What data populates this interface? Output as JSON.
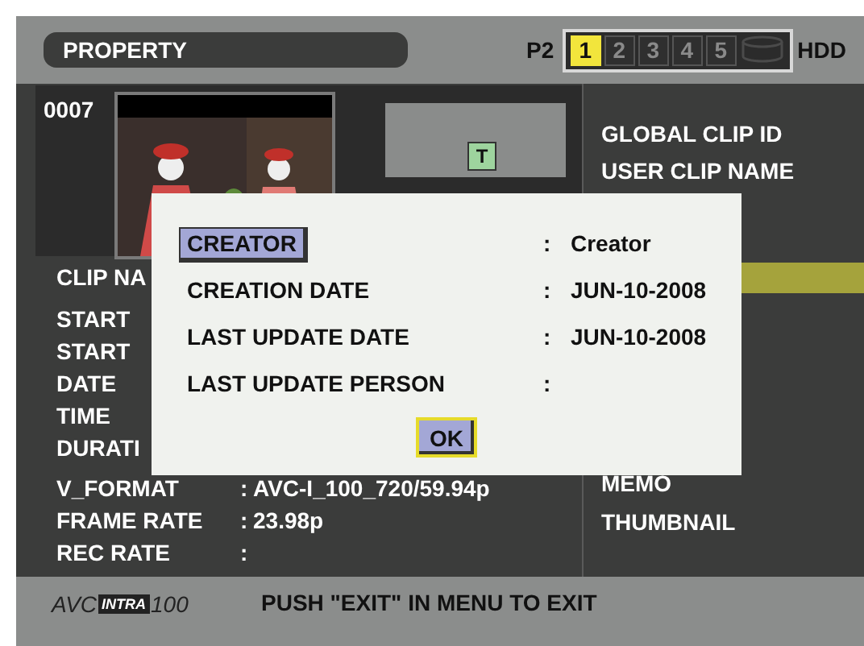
{
  "header": {
    "title": "PROPERTY",
    "media_label": "P2",
    "slots": [
      {
        "label": "1",
        "selected": true
      },
      {
        "label": "2",
        "selected": false
      },
      {
        "label": "3",
        "selected": false
      },
      {
        "label": "4",
        "selected": false
      },
      {
        "label": "5",
        "selected": false
      }
    ],
    "hdd_label": "HDD"
  },
  "clip": {
    "number": "0007",
    "badge": "T"
  },
  "clip_fields": [
    {
      "label": "CLIP NA"
    },
    {
      "label": "START"
    },
    {
      "label": "START"
    },
    {
      "label": "DATE"
    },
    {
      "label": "TIME"
    },
    {
      "label": "DURATI"
    }
  ],
  "format_fields": [
    {
      "label": "V_FORMAT",
      "separator": ":",
      "value": "AVC-I_100_720/59.94p"
    },
    {
      "label": "FRAME RATE",
      "separator": ":",
      "value": "23.98p"
    },
    {
      "label": "REC RATE",
      "separator": ":"
    }
  ],
  "side_menu": {
    "upper": [
      {
        "label": "GLOBAL CLIP ID"
      },
      {
        "label": "USER CLIP NAME"
      }
    ],
    "highlight": true,
    "lower": [
      {
        "label": "MEMO"
      },
      {
        "label": "THUMBNAIL"
      }
    ]
  },
  "dialog": {
    "rows": [
      {
        "label": "CREATOR",
        "separator": ":",
        "value": "Creator",
        "selected": true
      },
      {
        "label": "CREATION DATE",
        "separator": ":",
        "value": "JUN-10-2008",
        "selected": false
      },
      {
        "label": "LAST UPDATE DATE",
        "separator": ":",
        "value": "JUN-10-2008",
        "selected": false
      },
      {
        "label": "LAST UPDATE PERSON",
        "separator": ":",
        "selected": false
      }
    ],
    "ok": {
      "label": "OK",
      "selected": true
    }
  },
  "footer": {
    "logo": {
      "prefix": "AVC",
      "badge": "INTRA",
      "suffix": "100"
    },
    "message": "PUSH \"EXIT\" IN MENU TO EXIT"
  }
}
